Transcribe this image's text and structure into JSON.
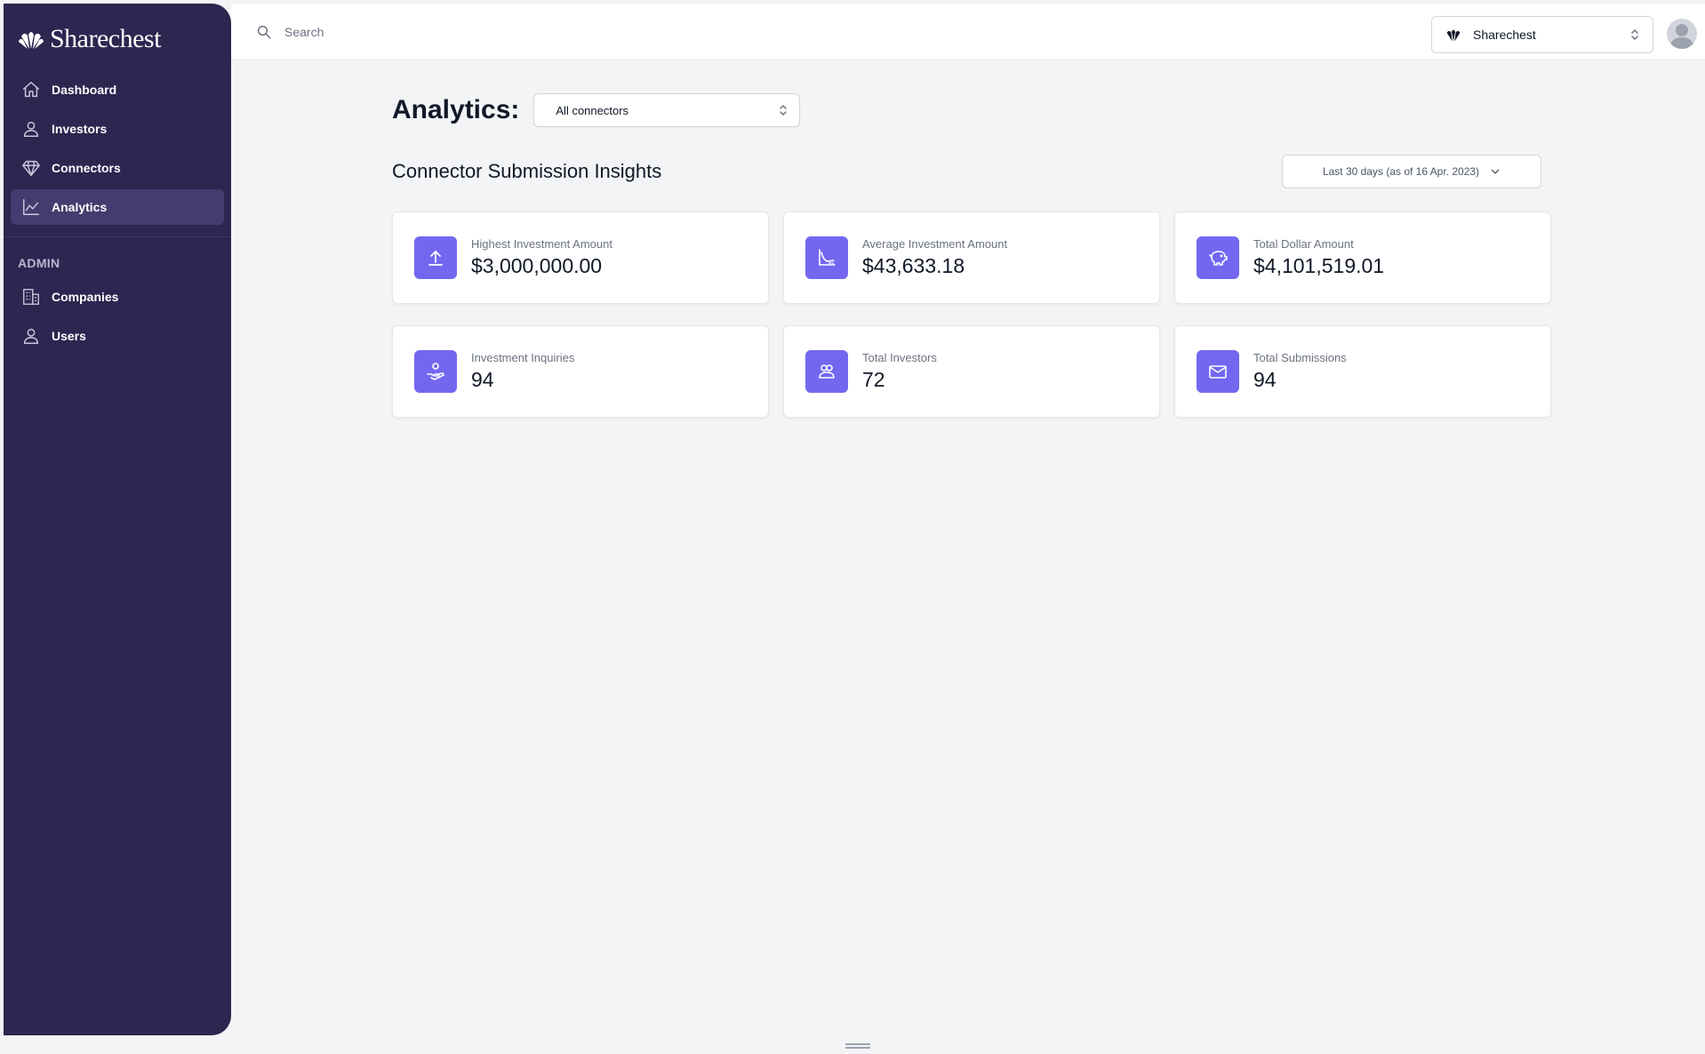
{
  "brand": {
    "name": "Sharechest"
  },
  "sidebar": {
    "items": [
      {
        "label": "Dashboard",
        "icon": "home-icon",
        "active": false
      },
      {
        "label": "Investors",
        "icon": "user-icon",
        "active": false
      },
      {
        "label": "Connectors",
        "icon": "diamond-icon",
        "active": false
      },
      {
        "label": "Analytics",
        "icon": "chart-line-icon",
        "active": true
      }
    ],
    "admin_label": "ADMIN",
    "admin_items": [
      {
        "label": "Companies",
        "icon": "building-icon"
      },
      {
        "label": "Users",
        "icon": "user-icon"
      }
    ]
  },
  "topbar": {
    "search_placeholder": "Search",
    "company_select_value": "Sharechest"
  },
  "main": {
    "title": "Analytics:",
    "connector_filter": "All connectors",
    "section_title": "Connector Submission Insights",
    "date_range": "Last 30 days (as of 16 Apr. 2023)",
    "cards": [
      {
        "label": "Highest Investment Amount",
        "value": "$3,000,000.00",
        "icon": "arrow-up-icon"
      },
      {
        "label": "Average Investment Amount",
        "value": "$43,633.18",
        "icon": "chart-curve-icon"
      },
      {
        "label": "Total Dollar Amount",
        "value": "$4,101,519.01",
        "icon": "piggy-bank-icon"
      },
      {
        "label": "Investment Inquiries",
        "value": "94",
        "icon": "hand-coin-icon"
      },
      {
        "label": "Total Investors",
        "value": "72",
        "icon": "users-icon"
      },
      {
        "label": "Total Submissions",
        "value": "94",
        "icon": "envelope-icon"
      }
    ]
  },
  "colors": {
    "sidebar_bg": "#2c2650",
    "sidebar_active": "#433c6e",
    "accent": "#7367f0",
    "page_bg": "#f3f4f6"
  }
}
